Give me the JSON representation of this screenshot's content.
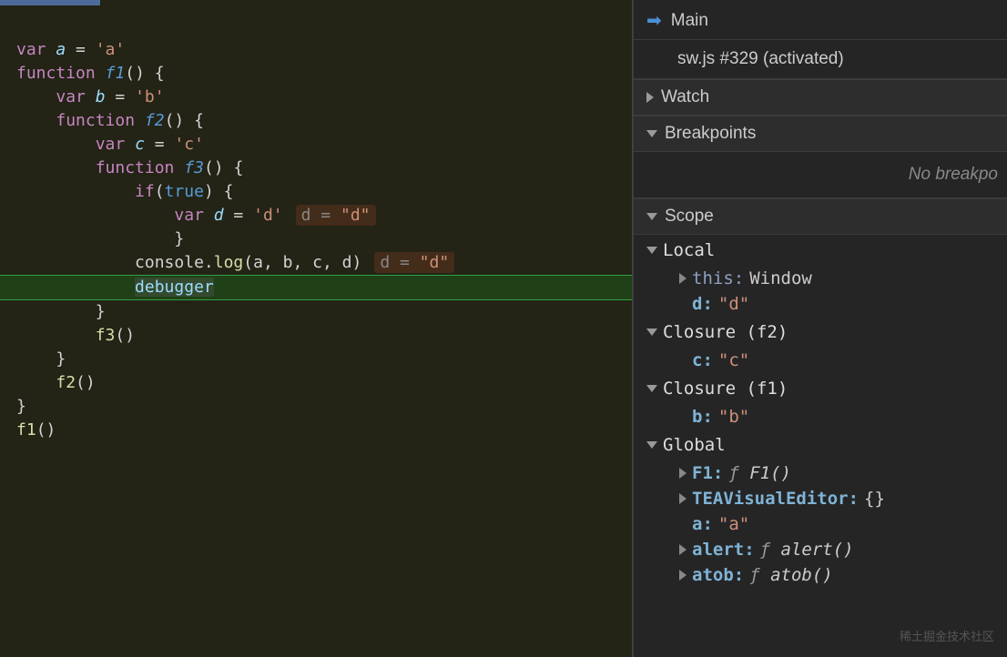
{
  "code": {
    "lines": [
      {
        "tokens": [
          {
            "t": "keyword",
            "v": "var "
          },
          {
            "t": "var",
            "v": "a"
          },
          {
            "t": "punc",
            "v": " = "
          },
          {
            "t": "string",
            "v": "'a'"
          }
        ]
      },
      {
        "tokens": [
          {
            "t": "keyword",
            "v": "function "
          },
          {
            "t": "func",
            "v": "f1"
          },
          {
            "t": "punc",
            "v": "() {"
          }
        ]
      },
      {
        "indent": 1,
        "tokens": [
          {
            "t": "keyword",
            "v": "var "
          },
          {
            "t": "var",
            "v": "b"
          },
          {
            "t": "punc",
            "v": " = "
          },
          {
            "t": "string",
            "v": "'b'"
          }
        ]
      },
      {
        "indent": 1,
        "tokens": [
          {
            "t": "keyword",
            "v": "function "
          },
          {
            "t": "func",
            "v": "f2"
          },
          {
            "t": "punc",
            "v": "() {"
          }
        ]
      },
      {
        "indent": 2,
        "tokens": [
          {
            "t": "keyword",
            "v": "var "
          },
          {
            "t": "var",
            "v": "c"
          },
          {
            "t": "punc",
            "v": " = "
          },
          {
            "t": "string",
            "v": "'c'"
          }
        ]
      },
      {
        "indent": 2,
        "tokens": [
          {
            "t": "keyword",
            "v": "function "
          },
          {
            "t": "func",
            "v": "f3"
          },
          {
            "t": "punc",
            "v": "() {"
          }
        ]
      },
      {
        "indent": 3,
        "tokens": [
          {
            "t": "cond",
            "v": "if"
          },
          {
            "t": "punc",
            "v": "("
          },
          {
            "t": "bool",
            "v": "true"
          },
          {
            "t": "punc",
            "v": ") {"
          }
        ]
      },
      {
        "indent": 4,
        "tokens": [
          {
            "t": "keyword",
            "v": "var "
          },
          {
            "t": "var",
            "v": "d"
          },
          {
            "t": "punc",
            "v": " = "
          },
          {
            "t": "string",
            "v": "'d'"
          }
        ],
        "hint": {
          "k": "d",
          "v": "\"d\""
        }
      },
      {
        "indent": 4,
        "tokens": [
          {
            "t": "punc",
            "v": "}"
          }
        ]
      },
      {
        "indent": 3,
        "tokens": [
          {
            "t": "ident",
            "v": "console"
          },
          {
            "t": "punc",
            "v": "."
          },
          {
            "t": "call",
            "v": "log"
          },
          {
            "t": "punc",
            "v": "(a, b, c, d)"
          }
        ],
        "hint": {
          "k": "d",
          "v": "\"d\""
        }
      },
      {
        "indent": 3,
        "highlight": true,
        "tokens": [
          {
            "t": "debugger",
            "v": "debugger"
          }
        ]
      },
      {
        "indent": 2,
        "tokens": [
          {
            "t": "punc",
            "v": "}"
          }
        ]
      },
      {
        "indent": 2,
        "tokens": [
          {
            "t": "call",
            "v": "f3"
          },
          {
            "t": "punc",
            "v": "()"
          }
        ]
      },
      {
        "indent": 1,
        "tokens": [
          {
            "t": "punc",
            "v": "}"
          }
        ]
      },
      {
        "indent": 1,
        "tokens": [
          {
            "t": "call",
            "v": "f2"
          },
          {
            "t": "punc",
            "v": "()"
          }
        ]
      },
      {
        "tokens": [
          {
            "t": "punc",
            "v": "}"
          }
        ]
      },
      {
        "tokens": [
          {
            "t": "call",
            "v": "f1"
          },
          {
            "t": "punc",
            "v": "()"
          }
        ]
      }
    ]
  },
  "sidebar": {
    "callstack": {
      "main_label": "Main",
      "worker_label": "sw.js #329 (activated)"
    },
    "watch_label": "Watch",
    "breakpoints_label": "Breakpoints",
    "no_breakpoints": "No breakpo",
    "scope_label": "Scope",
    "scopes": [
      {
        "name": "Local",
        "items": [
          {
            "expand": true,
            "key": "this",
            "keystyle": "plain",
            "val": "Window",
            "valstyle": "obj"
          },
          {
            "expand": false,
            "key": "d",
            "keystyle": "bold",
            "val": "\"d\"",
            "valstyle": "str"
          }
        ]
      },
      {
        "name": "Closure (f2)",
        "items": [
          {
            "expand": false,
            "key": "c",
            "keystyle": "bold",
            "val": "\"c\"",
            "valstyle": "str"
          }
        ]
      },
      {
        "name": "Closure (f1)",
        "items": [
          {
            "expand": false,
            "key": "b",
            "keystyle": "bold",
            "val": "\"b\"",
            "valstyle": "str"
          }
        ]
      },
      {
        "name": "Global",
        "items": [
          {
            "expand": true,
            "key": "F1",
            "keystyle": "bold",
            "val": "F1()",
            "valstyle": "func"
          },
          {
            "expand": true,
            "key": "TEAVisualEditor",
            "keystyle": "bold",
            "val": "{}",
            "valstyle": "obj"
          },
          {
            "expand": false,
            "key": "a",
            "keystyle": "bold",
            "val": "\"a\"",
            "valstyle": "str"
          },
          {
            "expand": true,
            "key": "alert",
            "keystyle": "bold",
            "val": "alert()",
            "valstyle": "func"
          },
          {
            "expand": true,
            "key": "atob",
            "keystyle": "bold",
            "val": "atob()",
            "valstyle": "func"
          }
        ]
      }
    ]
  },
  "watermark": "稀土掘金技术社区"
}
